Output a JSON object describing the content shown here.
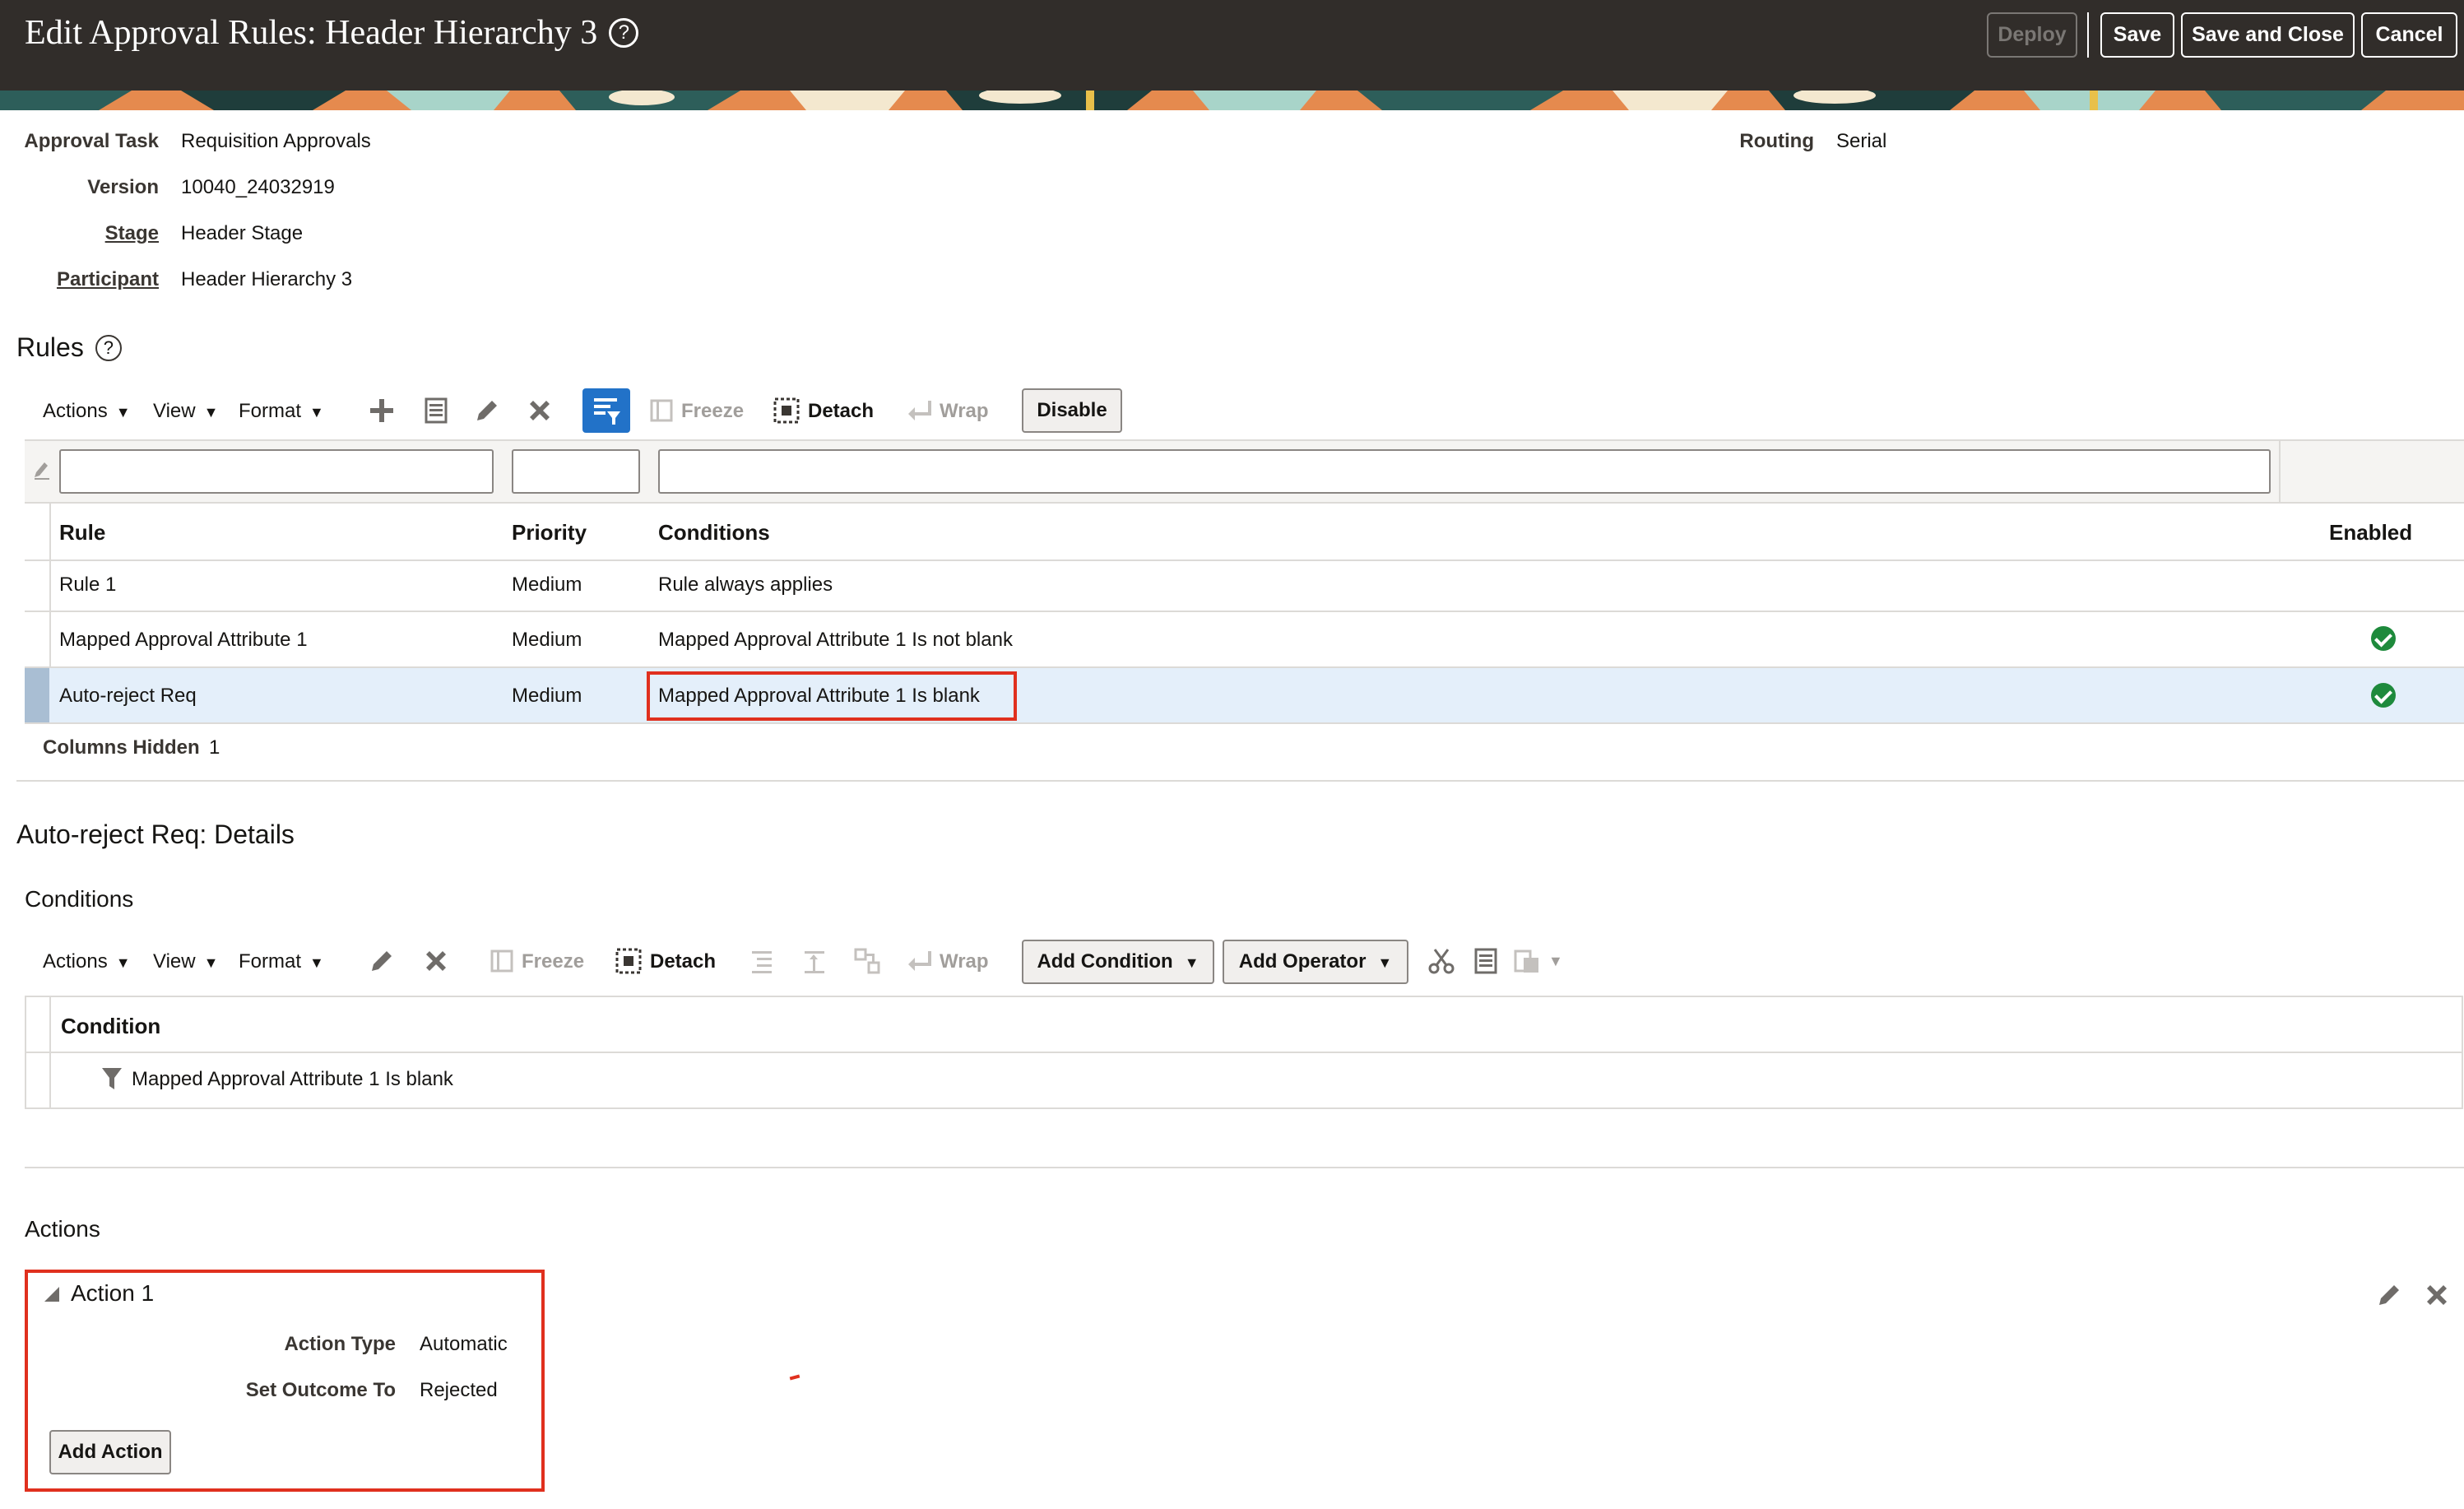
{
  "header": {
    "title": "Edit Approval Rules: Header Hierarchy 3",
    "help_glyph": "?",
    "buttons": {
      "deploy": "Deploy",
      "save": "Save",
      "save_close": "Save and Close",
      "cancel": "Cancel"
    }
  },
  "info": {
    "approval_task_label": "Approval Task",
    "approval_task_value": "Requisition Approvals",
    "version_label": "Version",
    "version_value": "10040_24032919",
    "stage_label": "Stage",
    "stage_value": "Header Stage",
    "participant_label": "Participant",
    "participant_value": "Header Hierarchy 3",
    "routing_label": "Routing",
    "routing_value": "Serial"
  },
  "rules": {
    "title": "Rules",
    "help_glyph": "?",
    "toolbar": {
      "actions": "Actions",
      "view": "View",
      "format": "Format",
      "freeze": "Freeze",
      "detach": "Detach",
      "wrap": "Wrap",
      "disable": "Disable"
    },
    "columns": {
      "rule": "Rule",
      "priority": "Priority",
      "conditions": "Conditions",
      "enabled": "Enabled"
    },
    "rows": [
      {
        "rule": "Rule 1",
        "priority": "Medium",
        "conditions": "Rule always applies",
        "enabled": false
      },
      {
        "rule": "Mapped Approval Attribute 1",
        "priority": "Medium",
        "conditions": "Mapped Approval Attribute 1 Is not blank",
        "enabled": true
      },
      {
        "rule": "Auto-reject Req",
        "priority": "Medium",
        "conditions": "Mapped Approval Attribute 1 Is blank",
        "enabled": true,
        "selected": true
      }
    ],
    "columns_hidden_label": "Columns Hidden",
    "columns_hidden_value": "1"
  },
  "details": {
    "title": "Auto-reject Req: Details",
    "conditions_title": "Conditions",
    "toolbar": {
      "actions": "Actions",
      "view": "View",
      "format": "Format",
      "freeze": "Freeze",
      "detach": "Detach",
      "wrap": "Wrap",
      "add_condition": "Add Condition",
      "add_operator": "Add Operator"
    },
    "condition_column": "Condition",
    "condition_rows": [
      "Mapped Approval Attribute 1 Is blank"
    ],
    "actions_title": "Actions",
    "action": {
      "name": "Action 1",
      "action_type_label": "Action Type",
      "action_type_value": "Automatic",
      "set_outcome_label": "Set Outcome To",
      "set_outcome_value": "Rejected",
      "add_action": "Add Action"
    }
  },
  "colors": {
    "header_bg": "#312d2a",
    "selected_row": "#e4effa",
    "highlight_border": "#e0301e",
    "enabled_check": "#1e8a3c",
    "active_tool": "#2272c8"
  }
}
